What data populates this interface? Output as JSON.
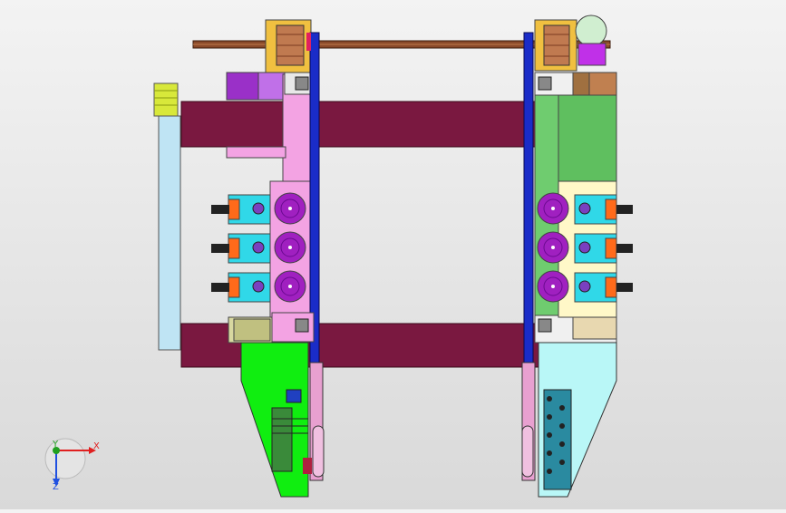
{
  "viewport": {
    "background_top": "#f3f3f3",
    "background_bottom": "#d9d9d9"
  },
  "triad": {
    "x_label": "X",
    "y_label": "Y",
    "z_label": "Z",
    "x_color": "#e02020",
    "y_color": "#20a020",
    "z_color": "#2050e0"
  },
  "colors": {
    "frame_beam": "#7a1840",
    "rail_blue": "#1a2cc8",
    "left_column": "#f3a3e3",
    "right_column": "#6fcc6f",
    "left_lower_plate": "#10ee10",
    "right_lower_plate": "#b9f7f7",
    "roller": "#a020c0",
    "gear_box": "#30d8e8",
    "motor_orange": "#ff6a1a",
    "shaft": "#8a4a2a",
    "side_panel": "#bfe4f4",
    "yellow_motor": "#d8e83a"
  }
}
